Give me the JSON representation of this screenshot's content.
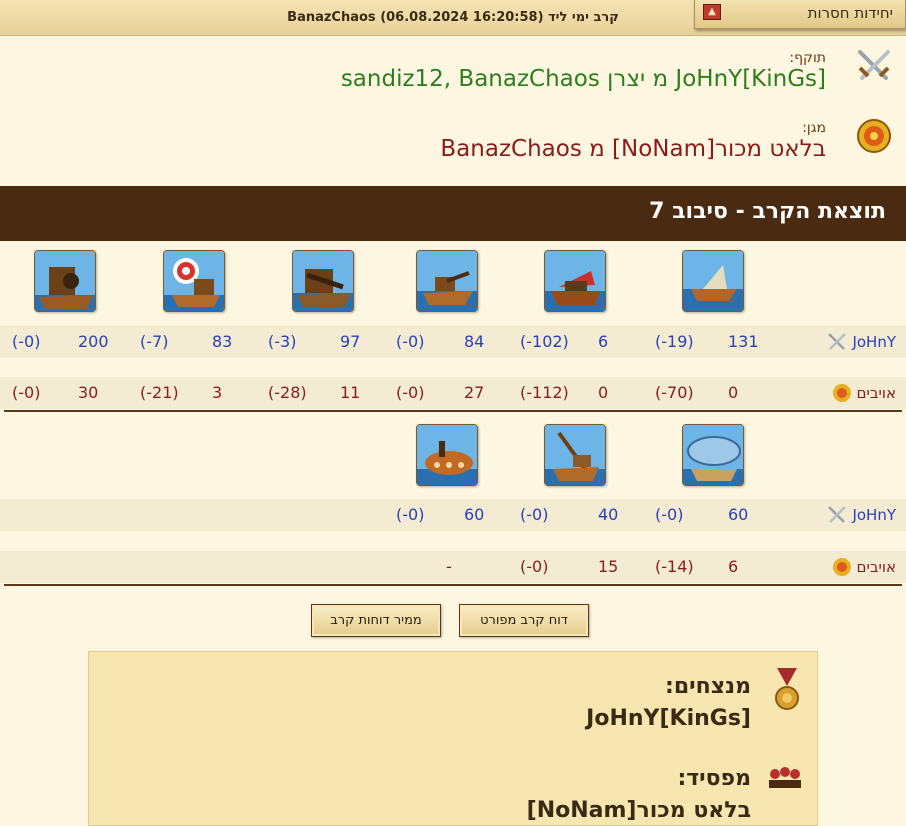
{
  "header": {
    "title": "קרב ימי ליד BanazChaos (06.08.2024 16:20:58)",
    "lost_units": "יחידות חסרות",
    "toggle_glyph": "▲"
  },
  "attacker": {
    "role": "תוקף:",
    "names": "JoHnY[KinGs] מ יצרן sandiz12, BanazChaos"
  },
  "defender": {
    "role": "מגן:",
    "names": "בלאט מכור[NoNam] מ BanazChaos"
  },
  "round": {
    "title": "תוצאת הקרב - סיבוב 7"
  },
  "labels": {
    "attacker_short": "JoHnY",
    "enemies": "אויבים"
  },
  "row1": {
    "units": [
      "ram-ship",
      "flame-thrower-ship",
      "ballista-ship",
      "steam-ram",
      "catapult-ship",
      "mortar-ship"
    ],
    "attacker": [
      {
        "count": "131",
        "loss": "(-19)"
      },
      {
        "count": "6",
        "loss": "(-102)"
      },
      {
        "count": "84",
        "loss": "(-0)"
      },
      {
        "count": "97",
        "loss": "(-3)"
      },
      {
        "count": "83",
        "loss": "(-7)"
      },
      {
        "count": "200",
        "loss": "(-0)"
      }
    ],
    "enemy": [
      {
        "count": "0",
        "loss": "(-70)"
      },
      {
        "count": "0",
        "loss": "(-112)"
      },
      {
        "count": "27",
        "loss": "(-0)"
      },
      {
        "count": "11",
        "loss": "(-28)"
      },
      {
        "count": "3",
        "loss": "(-21)"
      },
      {
        "count": "30",
        "loss": "(-0)"
      }
    ]
  },
  "row2": {
    "units": [
      "paddle-speedboat",
      "ballooncarrier",
      "tender"
    ],
    "attacker": [
      {
        "count": "60",
        "loss": "(-0)"
      },
      {
        "count": "40",
        "loss": "(-0)"
      },
      {
        "count": "60",
        "loss": "(-0)"
      }
    ],
    "enemy": [
      {
        "count": "6",
        "loss": "(-14)"
      },
      {
        "count": "15",
        "loss": "(-0)"
      },
      {
        "count": "-",
        "loss": ""
      }
    ]
  },
  "buttons": {
    "detailed": "דוח קרב מפורט",
    "converter": "ממיר דוחות קרב"
  },
  "result": {
    "winners_label": "מנצחים:",
    "winners": "JoHnY[KinGs]",
    "loser_label": "מפסיד:",
    "loser": "בלאט מכור[NoNam]"
  }
}
